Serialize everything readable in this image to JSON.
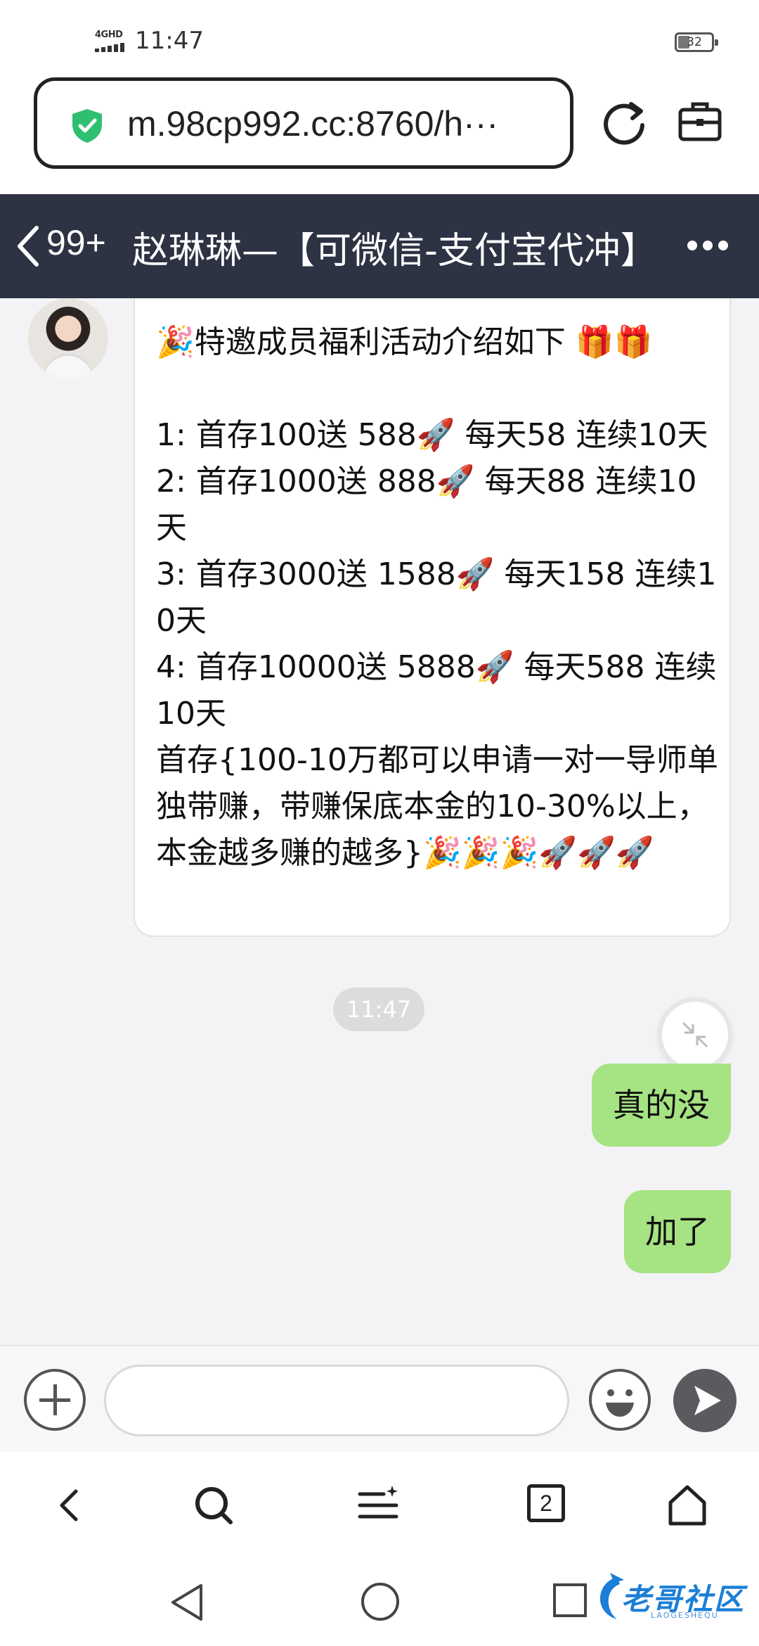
{
  "status_bar": {
    "network": "4GHD",
    "time": "11:47",
    "battery": "32"
  },
  "browser": {
    "url": "m.98cp992.cc:8760/h···"
  },
  "chat": {
    "unread_count": "99+",
    "title": "赵琳琳—【可微信-支付宝代冲】",
    "incoming_message": "🎉特邀成员福利活动介绍如下 🎁🎁\n\n1: 首存100送 588🚀 每天58 连续10天\n2: 首存1000送 888🚀 每天88 连续10天\n3: 首存3000送 1588🚀 每天158 连续10天\n4: 首存10000送 5888🚀 每天588 连续10天\n首存{100-10万都可以申请一对一导师单独带赚，带赚保底本金的10-30%以上，本金越多赚的越多}🎉🎉🎉🚀🚀🚀",
    "timestamp": "11:47",
    "outgoing_messages": [
      "真的没",
      "加了"
    ],
    "input_placeholder": ""
  },
  "browser_nav": {
    "tab_count": "2"
  },
  "watermark": {
    "text": "老哥社区",
    "sub": "LAOGESHEQU"
  },
  "colors": {
    "header_bg": "#2d3343",
    "outgoing_bubble": "#a6e382",
    "shield_green": "#2fbf71",
    "watermark_blue": "#1c7ed6"
  },
  "icons": [
    "shield-icon",
    "reload-icon",
    "toolbox-icon",
    "chevron-left-icon",
    "more-icon",
    "plus-icon",
    "emoji-icon",
    "send-icon",
    "back-icon",
    "search-icon",
    "menu-icon",
    "home-icon",
    "nav-back-icon",
    "nav-home-icon",
    "nav-recents-icon",
    "collapse-icon"
  ]
}
